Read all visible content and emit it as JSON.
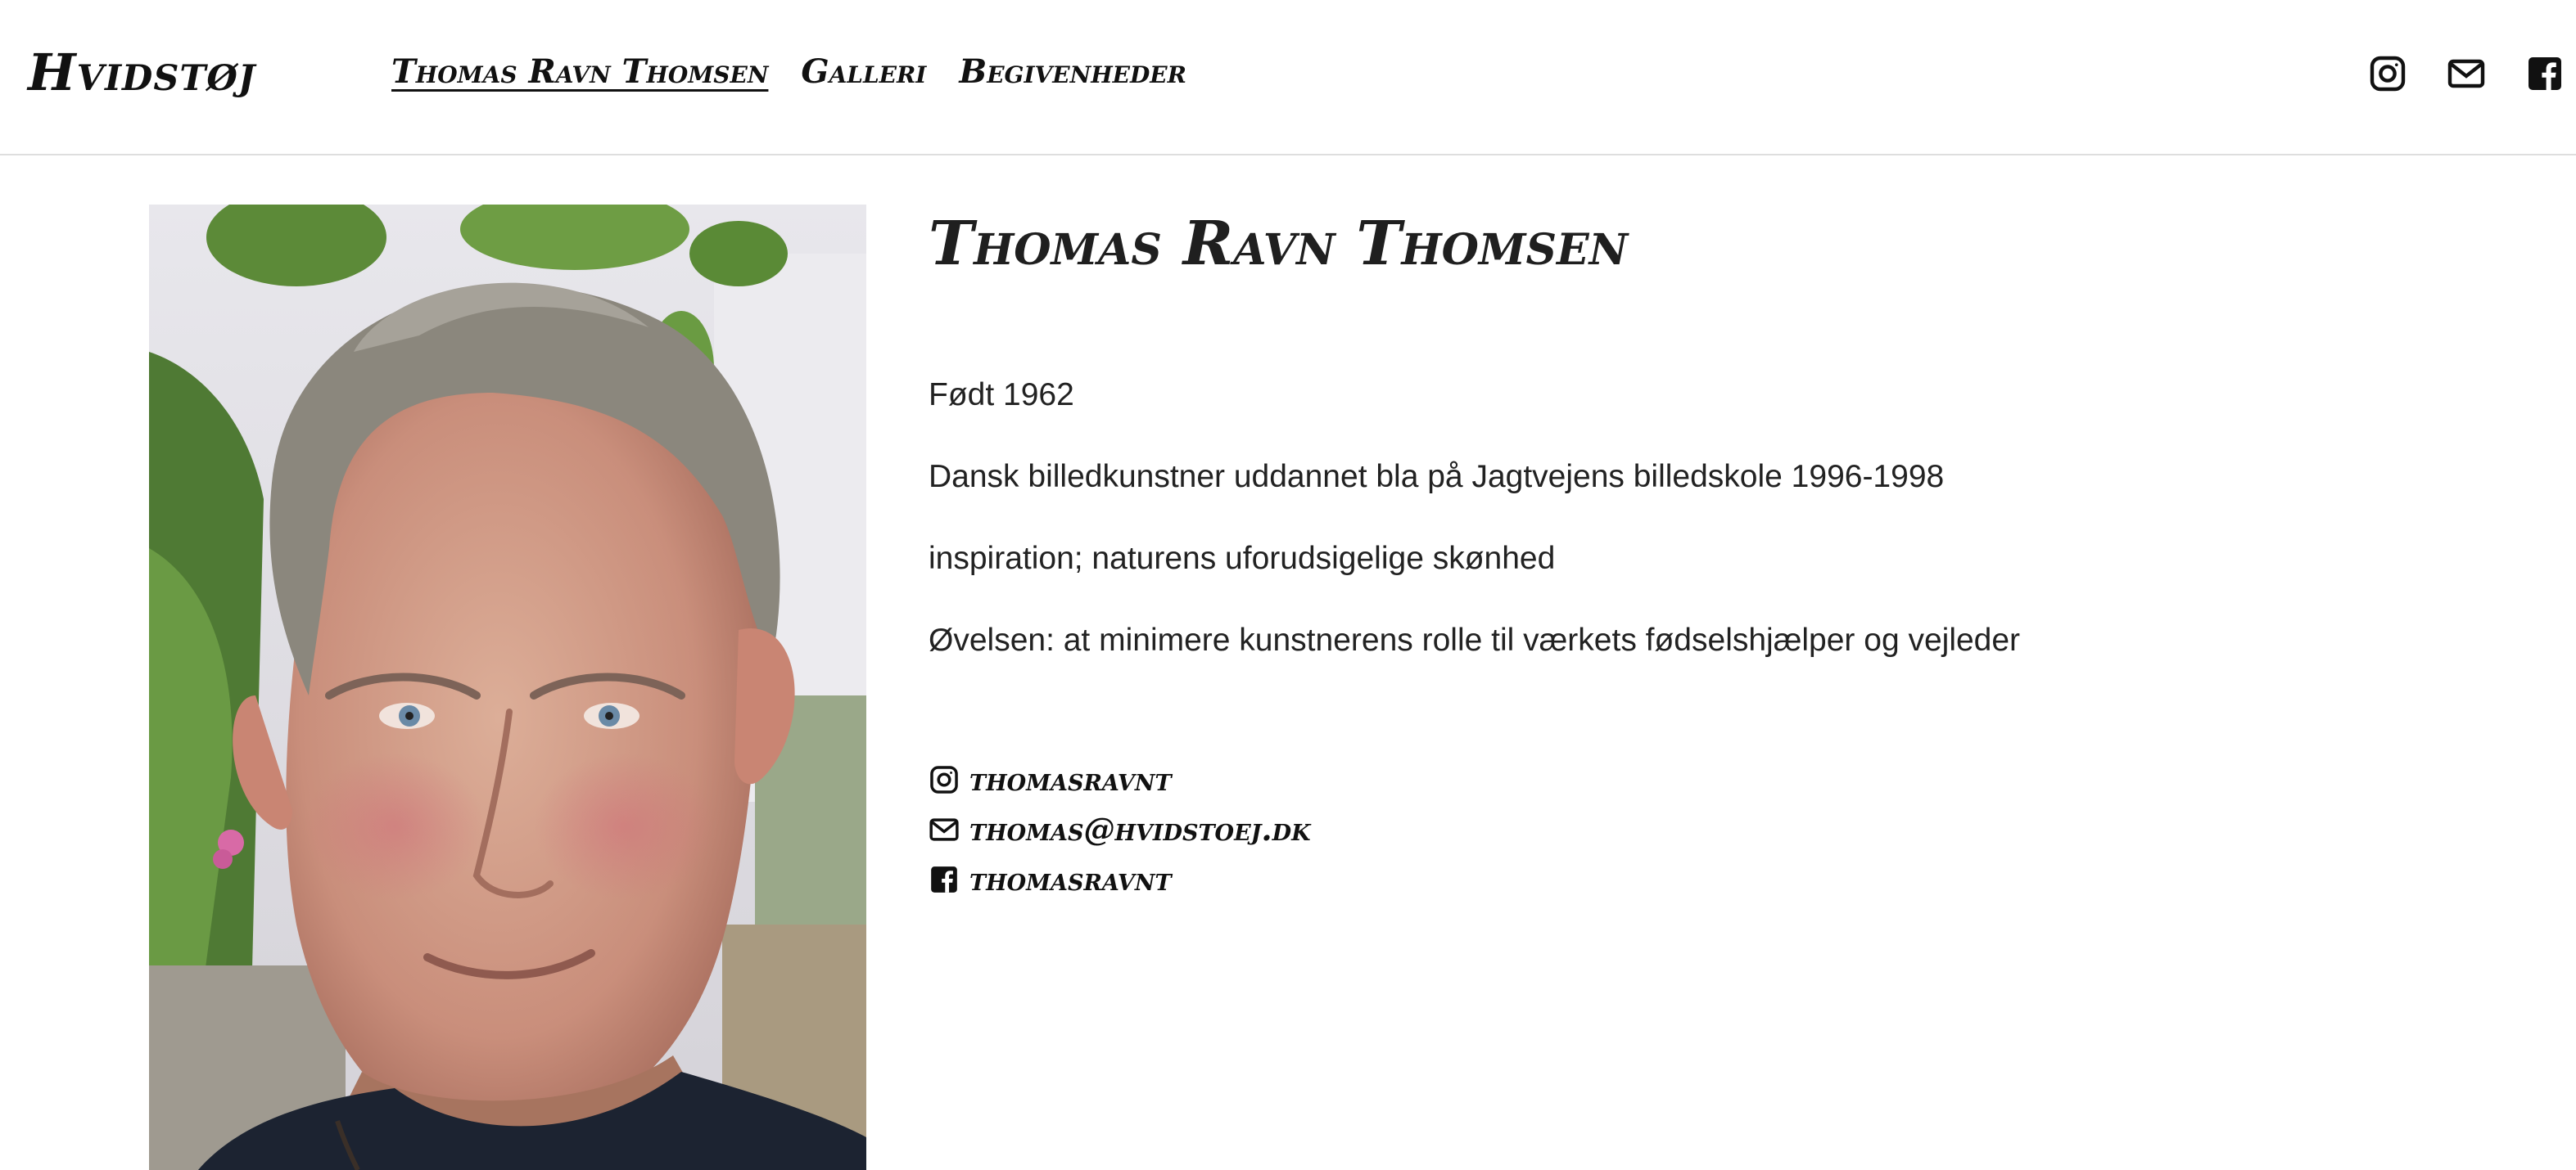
{
  "header": {
    "brand": "Hvidstøj",
    "nav": [
      {
        "label": "Thomas Ravn Thomsen",
        "active": true
      },
      {
        "label": "Galleri",
        "active": false
      },
      {
        "label": "Begivenheder",
        "active": false
      }
    ],
    "social_icons": [
      "instagram-icon",
      "mail-icon",
      "facebook-icon"
    ]
  },
  "profile": {
    "name": "Thomas Ravn Thomsen",
    "bio": [
      "Født 1962",
      "Dansk billedkunstner uddannet bla på Jagtvejens billedskole 1996-1998",
      "inspiration; naturens uforudsigelige skønhed",
      "Øvelsen: at minimere kunstnerens rolle til værkets fødselshjælper og vejleder"
    ],
    "contacts": {
      "instagram": "thomasravnt",
      "email": "thomas@hvidstoej.dk",
      "facebook": "thomasravnt"
    }
  },
  "colors": {
    "text": "#1b1b1b",
    "divider": "#dedede",
    "background": "#ffffff"
  }
}
